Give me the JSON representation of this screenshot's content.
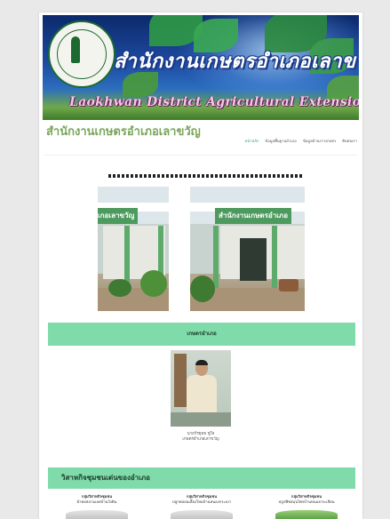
{
  "header": {
    "title_th": "สำนักงานเกษตรอำเภอเลาขวัญ",
    "title_en": "Laokhwan District Agricultural Extension Office"
  },
  "site": {
    "title": "สำนักงานเกษตรอำเภอเลาขวัญ"
  },
  "nav": {
    "items": [
      "หน้าหลัก",
      "ข้อมูลพื้นฐานอำเภอ",
      "ข้อมูลด้านการเกษตร",
      "ติดต่อเรา"
    ]
  },
  "slider": {
    "sign_left": "เกอเลาขวัญ",
    "sign_right": "สำนักงานเกษตรอำเภอ"
  },
  "section1": {
    "title": "เกษตรอำเภอ"
  },
  "officer": {
    "name": "นายวีรยุทธ ชูใจ",
    "position": "เกษตรอำเภอเลาขวัญ"
  },
  "section2": {
    "title": "วิสาหกิจชุมชนเด่นของอำเภอ"
  },
  "groups": [
    {
      "line1": "กลุ่มวิสาหกิจชุมชน",
      "line2": "ผ้าทอหลามเลยบ้านวังดิน"
    },
    {
      "line1": "กลุ่มวิสาหกิจชุมชน",
      "line2": "ปลูกหม่อนเลี้ยงไหมบ้านหนองกระเบา"
    },
    {
      "line1": "กลุ่มวิสาหกิจชุมชน",
      "line2": "ปลูกพืชสมุนไพรบ้านหนองกระเจียน"
    }
  ],
  "colors": {
    "accent": "#7fdba9",
    "title_green": "#7aa65a",
    "nav_active": "#3aa56a"
  }
}
